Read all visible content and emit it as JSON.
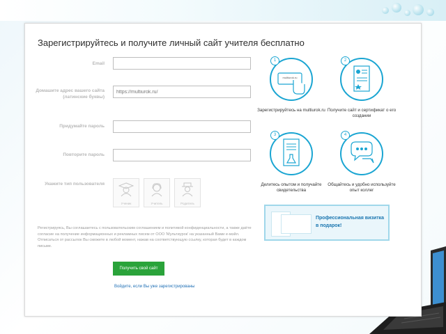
{
  "page": {
    "title": "Зарегистрируйтесь и получите личный сайт учителя бесплатно"
  },
  "form": {
    "email_label": "Email",
    "site_label": "Домашите адрес вашего сайта (латинские буквы)",
    "site_value": "https://multiurok.ru/",
    "password_label": "Придумайте пароль",
    "repeat_label": "Повторите пароль",
    "user_type_label": "Укажите тип пользователя",
    "roles": [
      {
        "label": "Ученик"
      },
      {
        "label": "Учитель"
      },
      {
        "label": "Родитель"
      }
    ],
    "notice": "Регистрируясь, Вы соглашаетесь с пользовательским соглашением и политикой конфиденциальности, а также даёте согласие на получение информационных и рекламных писем от ООО 'Мультиурок' на указанный Вами е-мэйл. Отписаться от рассылок Вы сможете в любой момент, нажав на соответствующую ссылку, которая будет в каждом письме.",
    "submit_label": "Получить свой сайт",
    "login_link": "Войдите, если Вы уже зарегистрированы"
  },
  "steps": [
    {
      "num": "1",
      "caption": "Зарегистрируйтесь на multiurok.ru",
      "screen_text": "multiurok.ru"
    },
    {
      "num": "2",
      "caption": "Получите сайт и сертификат о его создании"
    },
    {
      "num": "3",
      "caption": "Делитесь опытом и получайте свидетельства"
    },
    {
      "num": "4",
      "caption": "Общайтесь и удобно используйте опыт коллег"
    }
  ],
  "promo": {
    "text": "Профессиональная визитка в подарок!"
  },
  "colors": {
    "accent": "#1aa5d2",
    "submit": "#2aa33a",
    "link": "#1f6fb5"
  }
}
